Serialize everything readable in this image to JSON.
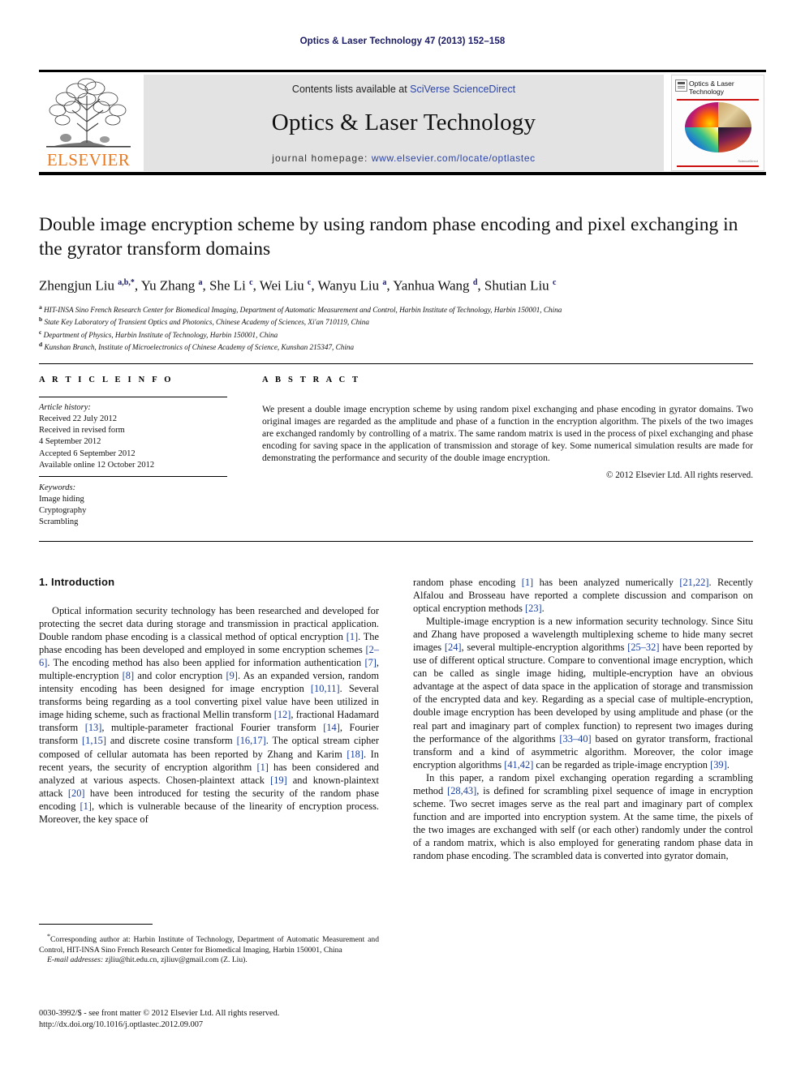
{
  "running_head": "Optics & Laser Technology 47 (2013) 152–158",
  "masthead": {
    "publisher_word": "ELSEVIER",
    "contents_prefix": "Contents lists available at ",
    "contents_link": "SciVerse ScienceDirect",
    "journal_title": "Optics & Laser Technology",
    "homepage_prefix": "journal homepage: ",
    "homepage_link": "www.elsevier.com/locate/optlastec",
    "cover": {
      "name_line1": "Optics & Laser",
      "name_line2": "Technology",
      "footnote": "ScienceDirect"
    },
    "colors": {
      "elsevier_orange": "#e87a22",
      "link_blue": "#2b44a8",
      "panel_gray": "#e3e3e3",
      "cover_red": "#cc1111"
    }
  },
  "article": {
    "title": "Double image encryption scheme by using random phase encoding and pixel exchanging in the gyrator transform domains",
    "authors_html": "Zhengjun Liu <sup>a,b,*</sup>, Yu Zhang <sup>a</sup>, She Li <sup>c</sup>, Wei Liu <sup>c</sup>, Wanyu Liu <sup>a</sup>, Yanhua Wang <sup>d</sup>, Shutian Liu <sup>c</sup>",
    "affiliations": [
      "<sup>a</sup> HIT-INSA Sino French Research Center for Biomedical Imaging, Department of Automatic Measurement and Control, Harbin Institute of Technology, Harbin 150001, China",
      "<sup>b</sup> State Key Laboratory of Transient Optics and Photonics, Chinese Academy of Sciences, Xi'an 710119, China",
      "<sup>c</sup> Department of Physics, Harbin Institute of Technology, Harbin 150001, China",
      "<sup>d</sup> Kunshan Branch, Institute of Microelectronics of Chinese Academy of Science, Kunshan 215347, China"
    ]
  },
  "section_heads": {
    "article_info": "A R T I C L E   I N F O",
    "abstract": "A B S T R A C T"
  },
  "article_info": {
    "history_label": "Article history:",
    "history_lines": [
      "Received 22 July 2012",
      "Received in revised form",
      "4 September 2012",
      "Accepted 6 September 2012",
      "Available online 12 October 2012"
    ],
    "keywords_label": "Keywords:",
    "keywords": [
      "Image hiding",
      "Cryptography",
      "Scrambling"
    ]
  },
  "abstract": {
    "text": "We present a double image encryption scheme by using random pixel exchanging and phase encoding in gyrator domains. Two original images are regarded as the amplitude and phase of a function in the encryption algorithm. The pixels of the two images are exchanged randomly by controlling of a matrix. The same random matrix is used in the process of pixel exchanging and phase encoding for saving space in the application of transmission and storage of key. Some numerical simulation results are made for demonstrating the performance and security of the double image encryption.",
    "copyright": "© 2012 Elsevier Ltd. All rights reserved."
  },
  "introduction": {
    "heading": "1.  Introduction",
    "left_paragraphs": [
      "Optical information security technology has been researched and developed for protecting the secret data during storage and transmission in practical application. Double random phase encoding is a classical method of optical encryption <span class=\"ref\">[1]</span>. The phase encoding has been developed and employed in some encryption schemes <span class=\"ref\">[2–6]</span>. The encoding method has also been applied for information authentication <span class=\"ref\">[7]</span>, multiple-encryption <span class=\"ref\">[8]</span> and color encryption <span class=\"ref\">[9]</span>. As an expanded version, random intensity encoding has been designed for image encryption <span class=\"ref\">[10,11]</span>. Several transforms being regarding as a tool converting pixel value have been utilized in image hiding scheme, such as fractional Mellin transform <span class=\"ref\">[12]</span>, fractional Hadamard transform <span class=\"ref\">[13]</span>, multiple-parameter fractional Fourier transform <span class=\"ref\">[14]</span>, Fourier transform <span class=\"ref\">[1,15]</span> and discrete cosine transform <span class=\"ref\">[16,17]</span>. The optical stream cipher composed of cellular automata has been reported by Zhang and Karim <span class=\"ref\">[18]</span>. In recent years, the security of encryption algorithm <span class=\"ref\">[1]</span> has been considered and analyzed at various aspects. Chosen-plaintext attack <span class=\"ref\">[19]</span> and known-plaintext attack <span class=\"ref\">[20]</span> have been introduced for testing the security of the random phase encoding <span class=\"ref\">[1]</span>, which is vulnerable because of the linearity of encryption process. Moreover, the key space of"
    ],
    "right_paragraphs": [
      "random phase encoding <span class=\"ref\">[1]</span> has been analyzed numerically <span class=\"ref\">[21,22]</span>. Recently Alfalou and Brosseau have reported a complete discussion and comparison on optical encryption methods <span class=\"ref\">[23]</span>.",
      "Multiple-image encryption is a new information security technology. Since Situ and Zhang have proposed a wavelength multiplexing scheme to hide many secret images <span class=\"ref\">[24]</span>, several multiple-encryption algorithms <span class=\"ref\">[25–32]</span> have been reported by use of different optical structure. Compare to conventional image encryption, which can be called as single image hiding, multiple-encryption have an obvious advantage at the aspect of data space in the application of storage and transmission of the encrypted data and key. Regarding as a special case of multiple-encryption, double image encryption has been developed by using amplitude and phase (or the real part and imaginary part of complex function) to represent two images during the performance of the algorithms <span class=\"ref\">[33–40]</span> based on gyrator transform, fractional transform and a kind of asymmetric algorithm. Moreover, the color image encryption algorithms <span class=\"ref\">[41,42]</span> can be regarded as triple-image encryption <span class=\"ref\">[39]</span>.",
      "In this paper, a random pixel exchanging operation regarding a scrambling method <span class=\"ref\">[28,43]</span>, is defined for scrambling pixel sequence of image in encryption scheme. Two secret images serve as the real part and imaginary part of complex function and are imported into encryption system. At the same time, the pixels of the two images are exchanged with self (or each other) randomly under the control of a random matrix, which is also employed for generating random phase data in random phase encoding. The scrambled data is converted into gyrator domain,"
    ]
  },
  "footnotes": {
    "corresponding": "<sup>*</sup>Corresponding author at: Harbin Institute of Technology, Department of Automatic Measurement and Control, HIT-INSA Sino French Research Center for Biomedical Imaging, Harbin 150001, China",
    "email": "<span class=\"ital\">E-mail addresses:</span> zjliu@hit.edu.cn, zjliuv@gmail.com (Z. Liu)."
  },
  "imprint": {
    "line1": "0030-3992/$ - see front matter © 2012 Elsevier Ltd. All rights reserved.",
    "line2": "http://dx.doi.org/10.1016/j.optlastec.2012.09.007"
  }
}
